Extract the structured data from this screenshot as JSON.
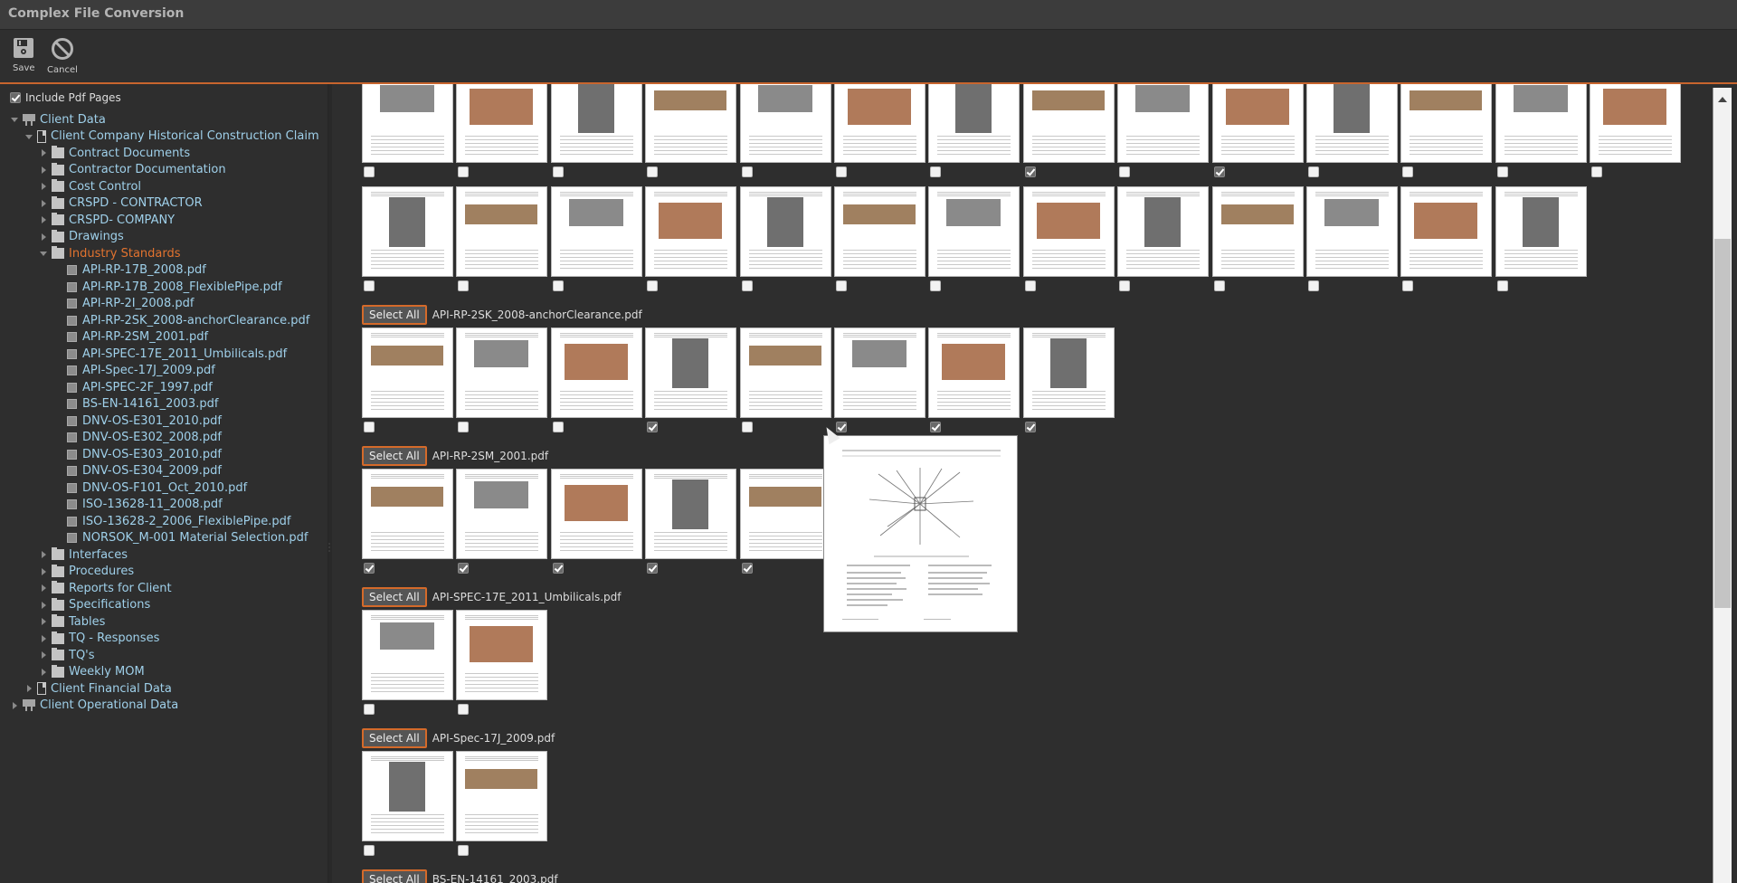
{
  "window": {
    "title": "Complex File Conversion"
  },
  "toolbar": {
    "save": {
      "label": "Save",
      "icon": "floppy-disk-icon"
    },
    "cancel": {
      "label": "Cancel",
      "icon": "prohibited-icon"
    }
  },
  "accent_color": "#d46a2a",
  "sidebar": {
    "include_pdf_pages": {
      "label": "Include Pdf Pages",
      "checked": true
    },
    "tree": [
      {
        "label": "Client Data",
        "level": 0,
        "icon": "board",
        "expanded": true
      },
      {
        "label": "Client Company Historical Construction Claim",
        "level": 1,
        "icon": "doc",
        "expanded": true
      },
      {
        "label": "Contract Documents",
        "level": 2,
        "icon": "folder",
        "expanded": false
      },
      {
        "label": "Contractor Documentation",
        "level": 2,
        "icon": "folder",
        "expanded": false
      },
      {
        "label": "Cost Control",
        "level": 2,
        "icon": "folder",
        "expanded": false
      },
      {
        "label": "CRSPD - CONTRACTOR",
        "level": 2,
        "icon": "folder",
        "expanded": false
      },
      {
        "label": "CRSPD- COMPANY",
        "level": 2,
        "icon": "folder",
        "expanded": false
      },
      {
        "label": "Drawings",
        "level": 2,
        "icon": "folder",
        "expanded": false
      },
      {
        "label": "Industry Standards",
        "level": 2,
        "icon": "folder",
        "expanded": true,
        "selected": true
      },
      {
        "label": "API-RP-17B_2008.pdf",
        "level": 3,
        "icon": "file"
      },
      {
        "label": "API-RP-17B_2008_FlexiblePipe.pdf",
        "level": 3,
        "icon": "file"
      },
      {
        "label": "API-RP-2I_2008.pdf",
        "level": 3,
        "icon": "file"
      },
      {
        "label": "API-RP-2SK_2008-anchorClearance.pdf",
        "level": 3,
        "icon": "file"
      },
      {
        "label": "API-RP-2SM_2001.pdf",
        "level": 3,
        "icon": "file"
      },
      {
        "label": "API-SPEC-17E_2011_Umbilicals.pdf",
        "level": 3,
        "icon": "file"
      },
      {
        "label": "API-Spec-17J_2009.pdf",
        "level": 3,
        "icon": "file"
      },
      {
        "label": "API-SPEC-2F_1997.pdf",
        "level": 3,
        "icon": "file"
      },
      {
        "label": "BS-EN-14161_2003.pdf",
        "level": 3,
        "icon": "file"
      },
      {
        "label": "DNV-OS-E301_2010.pdf",
        "level": 3,
        "icon": "file"
      },
      {
        "label": "DNV-OS-E302_2008.pdf",
        "level": 3,
        "icon": "file"
      },
      {
        "label": "DNV-OS-E303_2010.pdf",
        "level": 3,
        "icon": "file"
      },
      {
        "label": "DNV-OS-E304_2009.pdf",
        "level": 3,
        "icon": "file"
      },
      {
        "label": "DNV-OS-F101_Oct_2010.pdf",
        "level": 3,
        "icon": "file"
      },
      {
        "label": "ISO-13628-11_2008.pdf",
        "level": 3,
        "icon": "file"
      },
      {
        "label": "ISO-13628-2_2006_FlexiblePipe.pdf",
        "level": 3,
        "icon": "file"
      },
      {
        "label": "NORSOK_M-001 Material Selection.pdf",
        "level": 3,
        "icon": "file"
      },
      {
        "label": "Interfaces",
        "level": 2,
        "icon": "folder",
        "expanded": false
      },
      {
        "label": "Procedures",
        "level": 2,
        "icon": "folder",
        "expanded": false
      },
      {
        "label": "Reports for Client",
        "level": 2,
        "icon": "folder",
        "expanded": false
      },
      {
        "label": "Specifications",
        "level": 2,
        "icon": "folder",
        "expanded": false
      },
      {
        "label": "Tables",
        "level": 2,
        "icon": "folder",
        "expanded": false
      },
      {
        "label": "TQ - Responses",
        "level": 2,
        "icon": "folder",
        "expanded": false
      },
      {
        "label": "TQ's",
        "level": 2,
        "icon": "folder",
        "expanded": false
      },
      {
        "label": "Weekly MOM",
        "level": 2,
        "icon": "folder",
        "expanded": false
      },
      {
        "label": "Client Financial Data",
        "level": 1,
        "icon": "doc",
        "expanded": false
      },
      {
        "label": "Client Operational Data",
        "level": 0,
        "icon": "board",
        "expanded": false
      }
    ]
  },
  "content": {
    "select_all_label": "Select All",
    "sections": [
      {
        "title": "",
        "rows": [
          [
            false,
            false,
            false,
            false,
            false,
            false,
            false,
            true,
            false,
            true,
            false,
            false,
            false,
            false
          ],
          [
            false,
            false,
            false,
            false,
            false,
            false,
            false,
            false,
            false,
            false,
            false,
            false,
            false
          ]
        ]
      },
      {
        "title": "API-RP-2SK_2008-anchorClearance.pdf",
        "rows": [
          [
            false,
            false,
            false,
            true,
            false,
            true,
            true,
            true
          ]
        ]
      },
      {
        "title": "API-RP-2SM_2001.pdf",
        "rows": [
          [
            true,
            true,
            true,
            true,
            true
          ]
        ]
      },
      {
        "title": "API-SPEC-17E_2011_Umbilicals.pdf",
        "rows": [
          [
            false,
            false
          ]
        ]
      },
      {
        "title": "API-Spec-17J_2009.pdf",
        "rows": [
          [
            false,
            false
          ]
        ]
      },
      {
        "title": "BS-EN-14161_2003.pdf",
        "rows": []
      }
    ]
  }
}
